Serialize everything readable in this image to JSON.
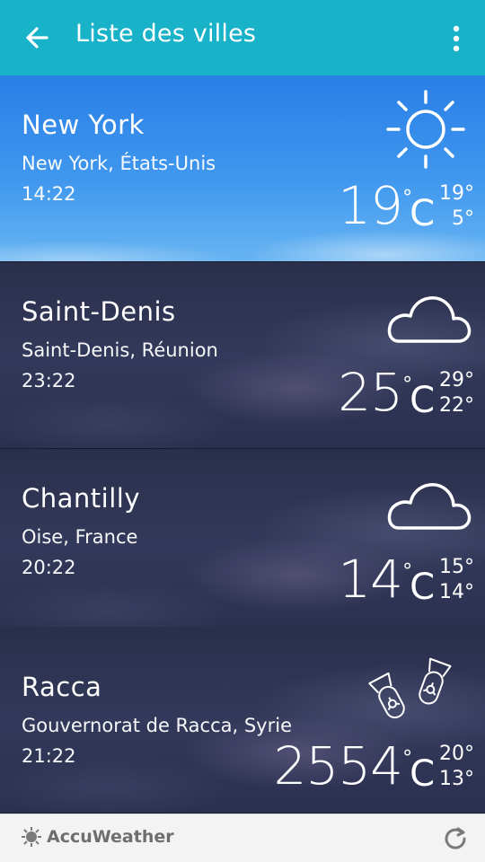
{
  "header": {
    "title": "Liste des villes",
    "back_icon": "arrow-left-icon",
    "menu_icon": "more-vert-icon"
  },
  "cities": [
    {
      "name": "New York",
      "region": "New York, États-Unis",
      "time": "14:22",
      "temp": "19",
      "unit": "C",
      "high": "19°",
      "low": "5°",
      "condition_icon": "sun-icon",
      "theme": "day"
    },
    {
      "name": "Saint-Denis",
      "region": "Saint-Denis, Réunion",
      "time": "23:22",
      "temp": "25",
      "unit": "C",
      "high": "29°",
      "low": "22°",
      "condition_icon": "cloud-icon",
      "theme": "night"
    },
    {
      "name": "Chantilly",
      "region": "Oise, France",
      "time": "20:22",
      "temp": "14",
      "unit": "C",
      "high": "15°",
      "low": "14°",
      "condition_icon": "cloud-icon",
      "theme": "night"
    },
    {
      "name": "Racca",
      "region": "Gouvernorat de Racca, Syrie",
      "time": "21:22",
      "temp": "2554",
      "unit": "C",
      "high": "20°",
      "low": "13°",
      "condition_icon": "bombs-icon",
      "theme": "night"
    }
  ],
  "footer": {
    "brand": "AccuWeather",
    "brand_icon": "sun-logo-icon",
    "refresh_icon": "refresh-icon"
  },
  "colors": {
    "appbar": "#18b2c9",
    "day_sky": "#3f97ee",
    "night_sky": "#2f3554",
    "footer": "#f3f3f3"
  }
}
